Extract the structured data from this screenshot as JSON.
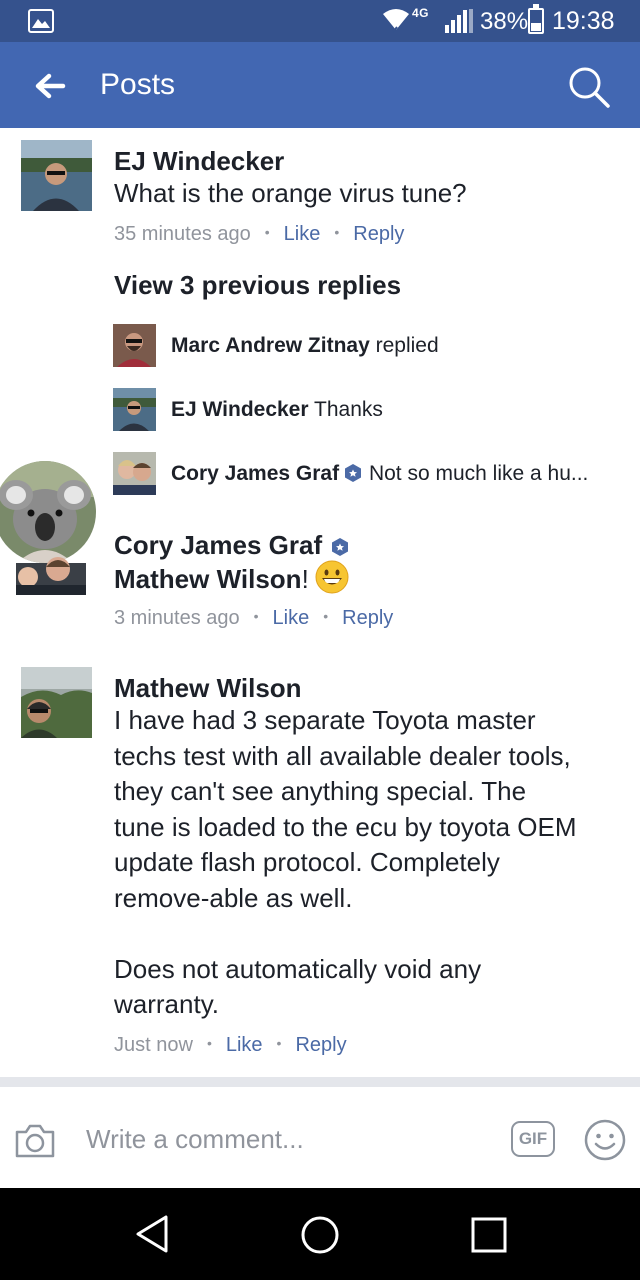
{
  "status_bar": {
    "network": "4G",
    "battery_percent": "38%",
    "battery_level": 0.38,
    "time": "19:38"
  },
  "app_bar": {
    "title": "Posts"
  },
  "colors": {
    "app_bar": "#4267b2",
    "status_bar": "#35528d",
    "link": "#4b6aa6",
    "meta_gray": "#90949c"
  },
  "comments": [
    {
      "author": "EJ Windecker",
      "text": "What is the orange virus tune?",
      "time": "35 minutes ago",
      "like": "Like",
      "reply": "Reply"
    },
    {
      "author": "Cory James Graf",
      "mention": "Mathew Wilson",
      "suffix": "!",
      "time": "3 minutes ago",
      "like": "Like",
      "reply": "Reply"
    },
    {
      "author": "Mathew Wilson",
      "lines": [
        "I have had 3 separate Toyota master",
        "techs test with all available dealer tools,",
        "they can't see anything special. The",
        "tune is loaded to the ecu by toyota OEM",
        "update flash protocol. Completely",
        "remove-able as well.",
        "",
        "Does not automatically void any",
        "warranty."
      ],
      "time": "Just now",
      "like": "Like",
      "reply": "Reply"
    }
  ],
  "view_previous": "View 3 previous replies",
  "replies": [
    {
      "name": "Marc Andrew Zitnay",
      "text": "replied"
    },
    {
      "name": "EJ Windecker",
      "text": "Thanks"
    },
    {
      "name": "Cory James Graf",
      "text": "Not so much like a hu..."
    }
  ],
  "composer": {
    "placeholder": "Write a comment...",
    "gif_label": "GIF"
  },
  "icons": {
    "status": [
      "image-icon",
      "wifi-icon",
      "signal-icon",
      "battery-icon"
    ],
    "app_bar": [
      "back-arrow-icon",
      "search-icon"
    ],
    "composer": [
      "camera-icon",
      "gif-icon",
      "smiley-icon"
    ],
    "nav": [
      "nav-back-icon",
      "nav-home-icon",
      "nav-recents-icon"
    ]
  }
}
